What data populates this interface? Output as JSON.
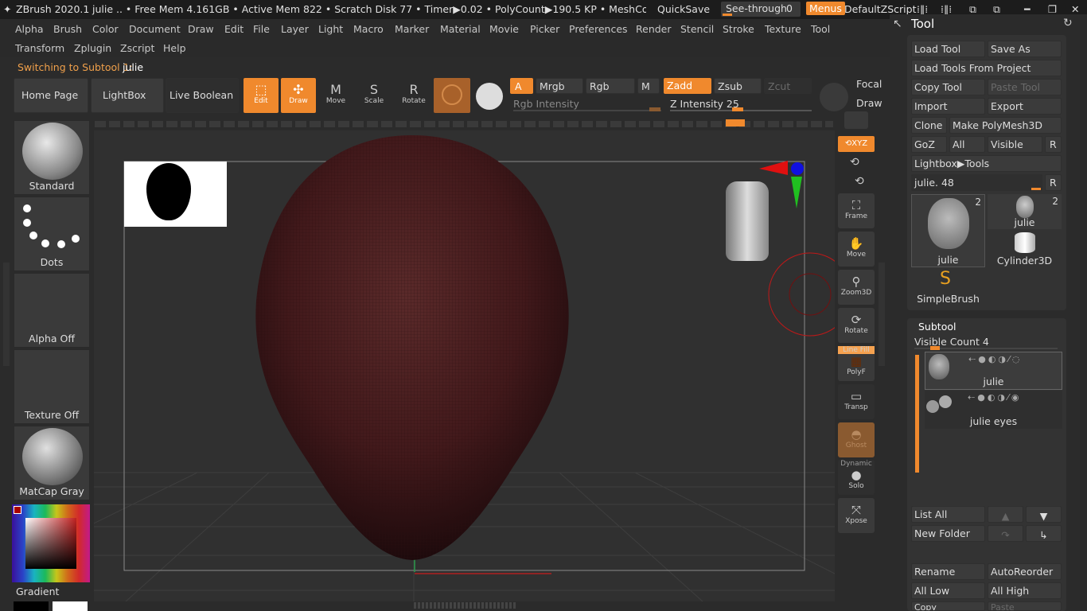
{
  "titlebar": {
    "app": "ZBrush 2020.1",
    "doc": "julie",
    "stats": ".. • Free Mem 4.161GB • Active Mem 822 • Scratch Disk 77 •  Timer▶0.02 • PolyCount▶190.5 KP  • MeshCount▶: AC",
    "quicksave": "QuickSave",
    "seethrough": "See-through",
    "seethrough_value": "0",
    "menus": "Menus",
    "script": "DefaultZScript"
  },
  "menubar": [
    "Alpha",
    "Brush",
    "Color",
    "Document",
    "Draw",
    "Edit",
    "File",
    "Layer",
    "Light",
    "Macro",
    "Marker",
    "Material",
    "Movie",
    "Picker",
    "Preferences",
    "Render",
    "Stencil",
    "Stroke",
    "Texture",
    "Tool"
  ],
  "menubar2": [
    "Transform",
    "Zplugin",
    "Zscript",
    "Help"
  ],
  "status": {
    "label": "Switching to Subtool 1:",
    "value": "julie"
  },
  "toolbar": {
    "home": "Home Page",
    "lightbox": "LightBox",
    "liveboolean": "Live Boolean",
    "edit": "Edit",
    "draw": "Draw",
    "move": "Move",
    "scale": "Scale",
    "rotate": "Rotate",
    "a": "A",
    "mrgb": "Mrgb",
    "rgb": "Rgb",
    "m": "M",
    "zadd": "Zadd",
    "zsub": "Zsub",
    "zcut": "Zcut",
    "rgb_intensity": "Rgb Intensity",
    "z_intensity": "Z Intensity 25",
    "focal": "Focal",
    "draw2": "Draw"
  },
  "left": {
    "brush": "Standard",
    "stroke": "Dots",
    "alpha": "Alpha Off",
    "texture": "Texture Off",
    "material": "MatCap Gray",
    "gradient": "Gradient"
  },
  "righttools": [
    "Frame",
    "Move",
    "Zoom3D",
    "Rotate",
    "PolyF",
    "Transp",
    "Ghost",
    "Solo",
    "Xpose"
  ],
  "righttools_extra": {
    "xyz": "XYZ",
    "linefill": "Line Fill",
    "dynamic": "Dynamic"
  },
  "tool_panel": {
    "title": "Tool",
    "buttons": [
      [
        "Load Tool",
        "Save As"
      ],
      [
        "Load Tools From Project"
      ],
      [
        "Copy Tool",
        "Paste Tool"
      ],
      [
        "Import",
        "Export"
      ],
      [
        "Clone",
        "Make PolyMesh3D"
      ],
      [
        "GoZ",
        "All",
        "Visible",
        "R"
      ],
      [
        "Lightbox▶Tools"
      ]
    ],
    "slider_label": "julie. 48",
    "slider_r": "R",
    "thumbs": [
      {
        "name": "julie",
        "count": "2"
      },
      {
        "name": "julie",
        "count": "2"
      },
      {
        "name": "Cylinder3D",
        "count": ""
      },
      {
        "name": "SimpleBrush",
        "count": ""
      }
    ]
  },
  "subtool": {
    "title": "Subtool",
    "visible_count": "Visible Count 4",
    "items": [
      "julie",
      "julie eyes"
    ],
    "list_all": "List All",
    "new_folder": "New Folder",
    "rename": "Rename",
    "autoreorder": "AutoReorder",
    "all_low": "All Low",
    "all_high": "All High",
    "copy": "Copy",
    "paste": "Paste"
  }
}
